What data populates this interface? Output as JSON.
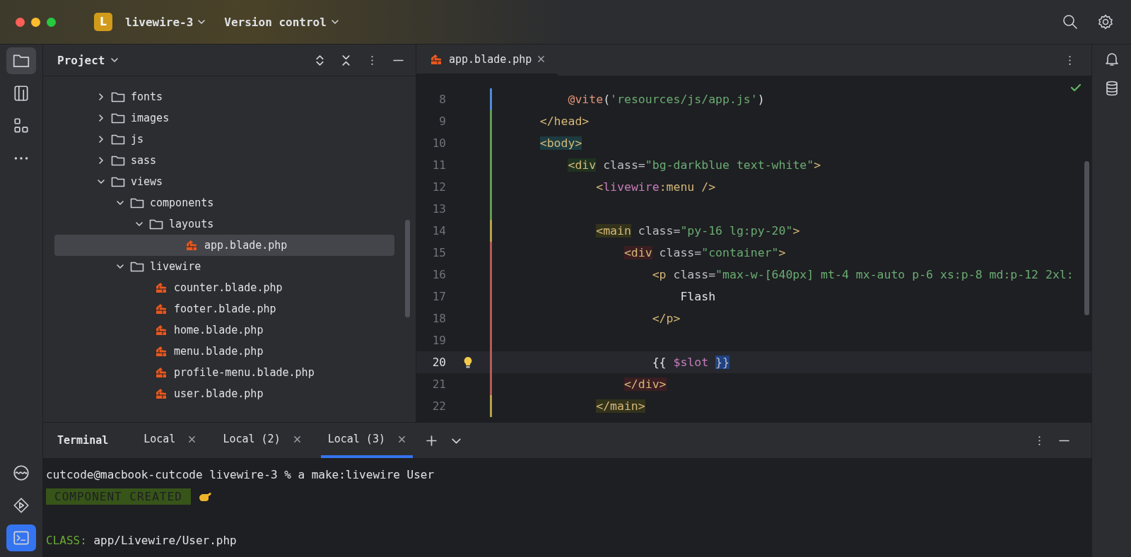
{
  "titlebar": {
    "project_badge": "L",
    "project": "livewire-3",
    "vcs": "Version control"
  },
  "project_panel": {
    "title": "Project",
    "tree": [
      {
        "kind": "folder",
        "name": "fonts",
        "expanded": false,
        "selected": false
      },
      {
        "kind": "folder",
        "name": "images",
        "expanded": false,
        "selected": false
      },
      {
        "kind": "folder",
        "name": "js",
        "expanded": false,
        "selected": false
      },
      {
        "kind": "folder",
        "name": "sass",
        "expanded": false,
        "selected": false
      },
      {
        "kind": "folder",
        "name": "views",
        "expanded": true,
        "selected": false,
        "children": [
          {
            "kind": "folder",
            "name": "components",
            "expanded": true,
            "selected": false,
            "children": [
              {
                "kind": "folder",
                "name": "layouts",
                "expanded": true,
                "selected": false,
                "children": [
                  {
                    "kind": "file",
                    "name": "app.blade.php",
                    "selected": true
                  }
                ]
              }
            ]
          },
          {
            "kind": "folder",
            "name": "livewire",
            "expanded": true,
            "selected": false,
            "children": [
              {
                "kind": "file",
                "name": "counter.blade.php",
                "selected": false
              },
              {
                "kind": "file",
                "name": "footer.blade.php",
                "selected": false
              },
              {
                "kind": "file",
                "name": "home.blade.php",
                "selected": false
              },
              {
                "kind": "file",
                "name": "menu.blade.php",
                "selected": false
              },
              {
                "kind": "file",
                "name": "profile-menu.blade.php",
                "selected": false
              },
              {
                "kind": "file",
                "name": "user.blade.php",
                "selected": false
              }
            ]
          }
        ]
      }
    ]
  },
  "editor": {
    "tab": "app.blade.php",
    "lines": [
      {
        "children": [
          {
            "number": "8",
            "selected": false,
            "color": "#4e8ad9",
            "tokens": [
              {
                "kind": "directive",
                "text": "@vite"
              },
              {
                "kind": "plain",
                "text": "("
              },
              {
                "kind": "string",
                "text": "'resources/js/app.js'"
              },
              {
                "kind": "plain",
                "text": ")"
              }
            ]
          }
        ]
      },
      {
        "number": "9",
        "selected": false,
        "color": "#5f9e4e",
        "tokens": [
          {
            "kind": "tag",
            "text": "</head>"
          }
        ]
      },
      {
        "number": "10",
        "selected": false,
        "color": "#5f9e4e",
        "tokens": [
          {
            "kind": "tag",
            "text": "<body>",
            "color": "#1d3b40"
          }
        ],
        "children": [
          {
            "number": "11",
            "selected": false,
            "color": "#5f9e4e",
            "tokens": [
              {
                "kind": "tag",
                "text": "<div",
                "color": "#1f3320"
              },
              {
                "kind": "attr",
                "text": " class="
              },
              {
                "kind": "string",
                "text": "\"bg-darkblue text-white\""
              },
              {
                "kind": "tag",
                "text": ">"
              }
            ],
            "children": [
              {
                "number": "12",
                "selected": false,
                "color": "#5f9e4e",
                "tokens": [
                  {
                    "kind": "tag",
                    "text": "<"
                  },
                  {
                    "kind": "namespace",
                    "text": "livewire"
                  },
                  {
                    "kind": "tag",
                    "text": ":menu />"
                  }
                ]
              },
              {
                "number": "13",
                "selected": false,
                "color": "#5f9e4e"
              },
              {
                "number": "14",
                "selected": false,
                "color": "#b5a34a",
                "tokens": [
                  {
                    "kind": "tag",
                    "text": "<main",
                    "color": "#33331c"
                  },
                  {
                    "kind": "attr",
                    "text": " class="
                  },
                  {
                    "kind": "string",
                    "text": "\"py-16 lg:py-20\""
                  },
                  {
                    "kind": "tag",
                    "text": ">"
                  }
                ],
                "children": [
                  {
                    "number": "15",
                    "selected": false,
                    "color": "#b55a5a",
                    "tokens": [
                      {
                        "kind": "tag",
                        "text": "<div",
                        "color": "#3a1e22"
                      },
                      {
                        "kind": "attr",
                        "text": " class="
                      },
                      {
                        "kind": "string",
                        "text": "\"container\""
                      },
                      {
                        "kind": "tag",
                        "text": ">"
                      }
                    ],
                    "children": [
                      {
                        "number": "16",
                        "selected": false,
                        "color": "#b55a5a",
                        "tokens": [
                          {
                            "kind": "tag",
                            "text": "<p"
                          },
                          {
                            "kind": "attr",
                            "text": " class="
                          },
                          {
                            "kind": "string",
                            "text": "\"max-w-[640px] mt-4 mx-auto p-6 xs:p-8 md:p-12 2xl:"
                          }
                        ],
                        "children": [
                          {
                            "number": "17",
                            "selected": false,
                            "color": "#b55a5a",
                            "tokens": [
                              {
                                "kind": "plain",
                                "text": "Flash"
                              }
                            ]
                          }
                        ]
                      },
                      {
                        "number": "18",
                        "selected": false,
                        "color": "#b55a5a",
                        "tokens": [
                          {
                            "kind": "tag",
                            "text": "</p>"
                          }
                        ]
                      },
                      {
                        "number": "19",
                        "selected": false,
                        "color": "#b55a5a"
                      },
                      {
                        "number": "20",
                        "selected": true,
                        "color": "#b55a5a",
                        "tokens": [
                          {
                            "kind": "plain",
                            "text": "{{ "
                          },
                          {
                            "kind": "variable",
                            "text": "$slot "
                          },
                          {
                            "kind": "brace",
                            "text": "}}"
                          }
                        ]
                      }
                    ]
                  },
                  {
                    "number": "21",
                    "selected": false,
                    "color": "#b55a5a",
                    "tokens": [
                      {
                        "kind": "tag",
                        "text": "</div>",
                        "color": "#3a1e22"
                      }
                    ]
                  }
                ]
              },
              {
                "number": "22",
                "selected": false,
                "color": "#b5a34a",
                "tokens": [
                  {
                    "kind": "tag",
                    "text": "</main>",
                    "color": "#33331c"
                  }
                ]
              }
            ]
          }
        ]
      }
    ]
  },
  "terminal": {
    "title": "Terminal",
    "tabs": [
      {
        "label": "Local",
        "selected": false
      },
      {
        "label": "Local (2)",
        "selected": false
      },
      {
        "label": "Local (3)",
        "selected": true
      }
    ],
    "lines": [
      {
        "kind": "command",
        "text": "cutcode@macbook-cutcode livewire-3 % a make:livewire User"
      },
      {
        "kind": "badge",
        "text": "COMPONENT CREATED"
      },
      {
        "kind": "field",
        "label": "CLASS:",
        "text": "app/Livewire/User.php"
      }
    ]
  }
}
